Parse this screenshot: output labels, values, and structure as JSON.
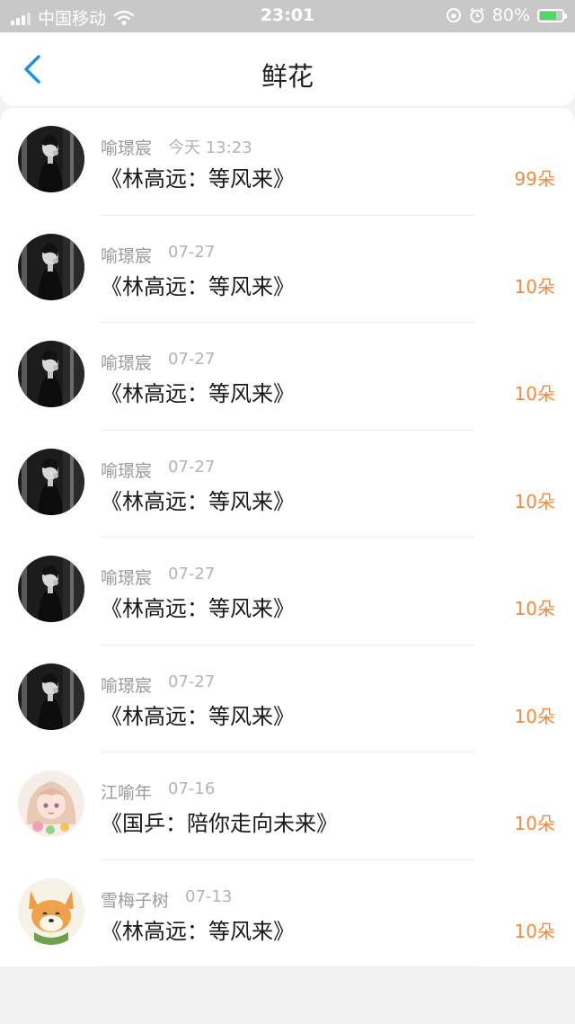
{
  "status_bar": {
    "carrier": "中国移动",
    "time": "23:01",
    "battery": "80%"
  },
  "nav": {
    "title": "鲜花"
  },
  "items": [
    {
      "name": "喻璟宸",
      "date": "今天 13:23",
      "work": "《林高远：等风来》",
      "count": "99朵",
      "avatar": "dark"
    },
    {
      "name": "喻璟宸",
      "date": "07-27",
      "work": "《林高远：等风来》",
      "count": "10朵",
      "avatar": "dark"
    },
    {
      "name": "喻璟宸",
      "date": "07-27",
      "work": "《林高远：等风来》",
      "count": "10朵",
      "avatar": "dark"
    },
    {
      "name": "喻璟宸",
      "date": "07-27",
      "work": "《林高远：等风来》",
      "count": "10朵",
      "avatar": "dark"
    },
    {
      "name": "喻璟宸",
      "date": "07-27",
      "work": "《林高远：等风来》",
      "count": "10朵",
      "avatar": "dark"
    },
    {
      "name": "喻璟宸",
      "date": "07-27",
      "work": "《林高远：等风来》",
      "count": "10朵",
      "avatar": "dark"
    },
    {
      "name": "江喻年",
      "date": "07-16",
      "work": "《国乒：陪你走向未来》",
      "count": "10朵",
      "avatar": "anime"
    },
    {
      "name": "雪梅子树",
      "date": "07-13",
      "work": "《林高远：等风来》",
      "count": "10朵",
      "avatar": "dog"
    }
  ],
  "colors": {
    "accent": "#1e8fe6",
    "count": "#f08a3e",
    "battery": "#4cd964"
  }
}
